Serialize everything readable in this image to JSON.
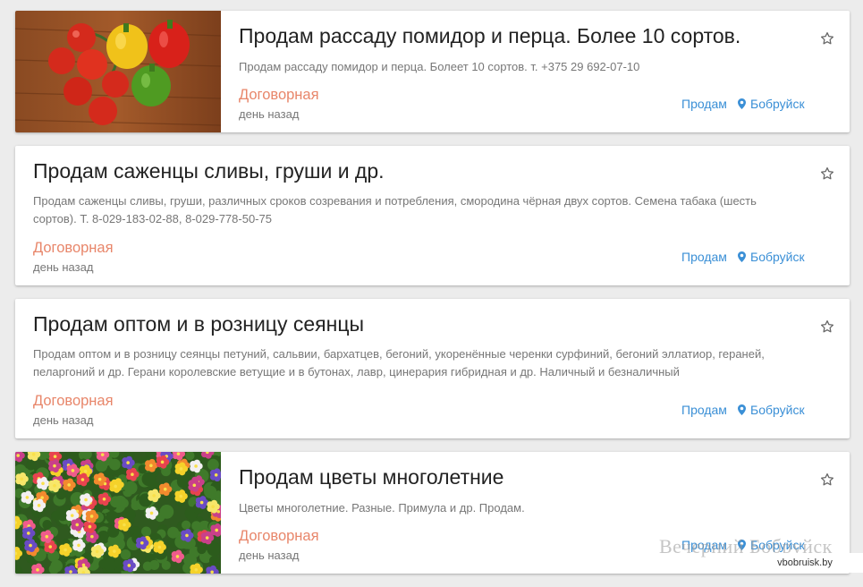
{
  "listings": [
    {
      "title": "Продам рассаду помидор и перца. Более 10 сортов.",
      "description": "Продам рассаду помидор и перца. Болеет 10 сортов. т. +375 29 692-07-10",
      "price": "Договорная",
      "date": "день назад",
      "category": "Продам",
      "city": "Бобруйск",
      "image": "tomatoes-peppers-photo"
    },
    {
      "title": "Продам саженцы сливы, груши и др.",
      "description": "Продам саженцы сливы, груши, различных сроков созревания и потребления, смородина чёрная двух сортов. Семена табака (шесть сортов). Т. 8-029-183-02-88, 8-029-778-50-75",
      "price": "Договорная",
      "date": "день назад",
      "category": "Продам",
      "city": "Бобруйск"
    },
    {
      "title": "Продам оптом и в розницу сеянцы",
      "description": "Продам оптом и в розницу сеянцы петуний, сальвии, бархатцев, бегоний, укоренённые черенки сурфиний, бегоний эллатиор, гераней, пеларгоний и др. Герани королевские ветущие и в бутонах, лавр, цинерария гибридная и др. Наличный и безналичный",
      "price": "Договорная",
      "date": "день назад",
      "category": "Продам",
      "city": "Бобруйск"
    },
    {
      "title": "Продам цветы многолетние",
      "description": "Цветы многолетние. Разные. Примула и др. Продам.",
      "price": "Договорная",
      "date": "день назад",
      "category": "Продам",
      "city": "Бобруйск",
      "image": "primula-flowers-photo"
    }
  ],
  "watermark": {
    "text": "Вечерний Бобруйск",
    "domain": "vbobruisk.by"
  },
  "colors": {
    "price": "#e8866a",
    "link": "#3a8fd6",
    "title": "#222222",
    "muted": "#777777"
  }
}
